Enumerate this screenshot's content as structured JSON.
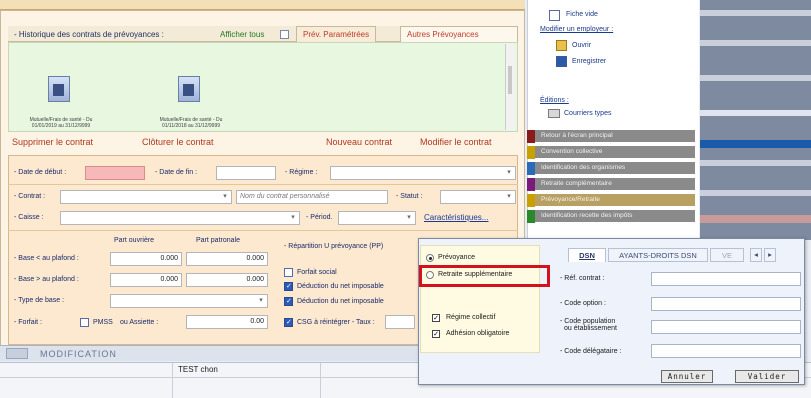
{
  "history": {
    "title": "- Historique des contrats de prévoyances :",
    "show_all": "Afficher tous",
    "tabs": [
      "Prév. Paramétrées",
      "Autres Prévoyances"
    ],
    "docs": [
      {
        "caption_1": "Mutuelle/Frais de santé - Du",
        "caption_2": "01/01/2019 au 31/12/9999"
      },
      {
        "caption_1": "Mutuelle/Frais de santé - Du",
        "caption_2": "01/11/2018 au 31/12/9999"
      }
    ]
  },
  "actions": {
    "delete": "Supprimer le contrat",
    "close": "Clôturer le contrat",
    "new": "Nouveau contrat",
    "modify": "Modifier le contrat"
  },
  "form": {
    "date_debut": "- Date de début :",
    "date_fin": "- Date de fin :",
    "regime": "- Régime :",
    "contrat": "- Contrat :",
    "contrat_placeholder": "Nom du contrat personnalisé",
    "statut": "- Statut :",
    "caisse": "- Caisse :",
    "period": "- Périod.",
    "caracteristiques": "Caractéristiques...",
    "part_ouvriere": "Part ouvrière",
    "part_patronale": "Part patronale",
    "base_inf": "- Base < au plafond :",
    "base_sup": "- Base > au plafond :",
    "type_base": "- Type de base :",
    "forfait": "- Forfait :",
    "pmss": "PMSS",
    "ou_assiette": "ou Assiette :",
    "val_inf_ouv": "0.000",
    "val_inf_pat": "0.000",
    "val_sup_ouv": "0.000",
    "val_sup_pat": "0.000",
    "val_forfait": "0.00",
    "repartition": "- Répartition U prévoyance (PP)",
    "forfait_social": "Forfait social",
    "deduction_1": "Déduction du net imposable",
    "deduction_2": "Déduction du net imposable",
    "csg": "CSG à réintégrer - Taux :"
  },
  "modification": "MODIFICATION",
  "grid_cell": "TEST chon",
  "right": {
    "fiche_vide": "Fiche vide",
    "modifier": "Modifier un employeur :",
    "ouvrir": "Ouvrir",
    "enregistrer": "Enregistrer",
    "editions": "Éditions :",
    "courriers": "Courriers types",
    "nav": [
      {
        "label": "Retour à l'écran principal",
        "color": "#8b1a1a"
      },
      {
        "label": "Convention collective",
        "color": "#c8a000"
      },
      {
        "label": "Identification des organismes",
        "color": "#2a6ab8"
      },
      {
        "label": "Retraite complémentaire",
        "color": "#7a1a7a"
      },
      {
        "label": "Prévoyance/Retraite",
        "color": "#c8a000"
      },
      {
        "label": "Identification recette des impôts",
        "color": "#2a8a2a"
      }
    ]
  },
  "dialog": {
    "radio_prevoyance": "Prévoyance",
    "radio_retraite": "Retraite supplémentaire",
    "regime_collectif": "Régime collectif",
    "adhesion": "Adhésion obligatoire",
    "tabs": [
      "DSN",
      "AYANTS-DROITS DSN",
      "VE"
    ],
    "ref_contrat": "- Réf. contrat :",
    "code_option": "- Code option :",
    "code_population_1": "- Code population",
    "code_population_2": "ou établissement",
    "code_delegataire": "- Code délégataire :",
    "annuler": "Annuler",
    "valider": "Valider"
  }
}
